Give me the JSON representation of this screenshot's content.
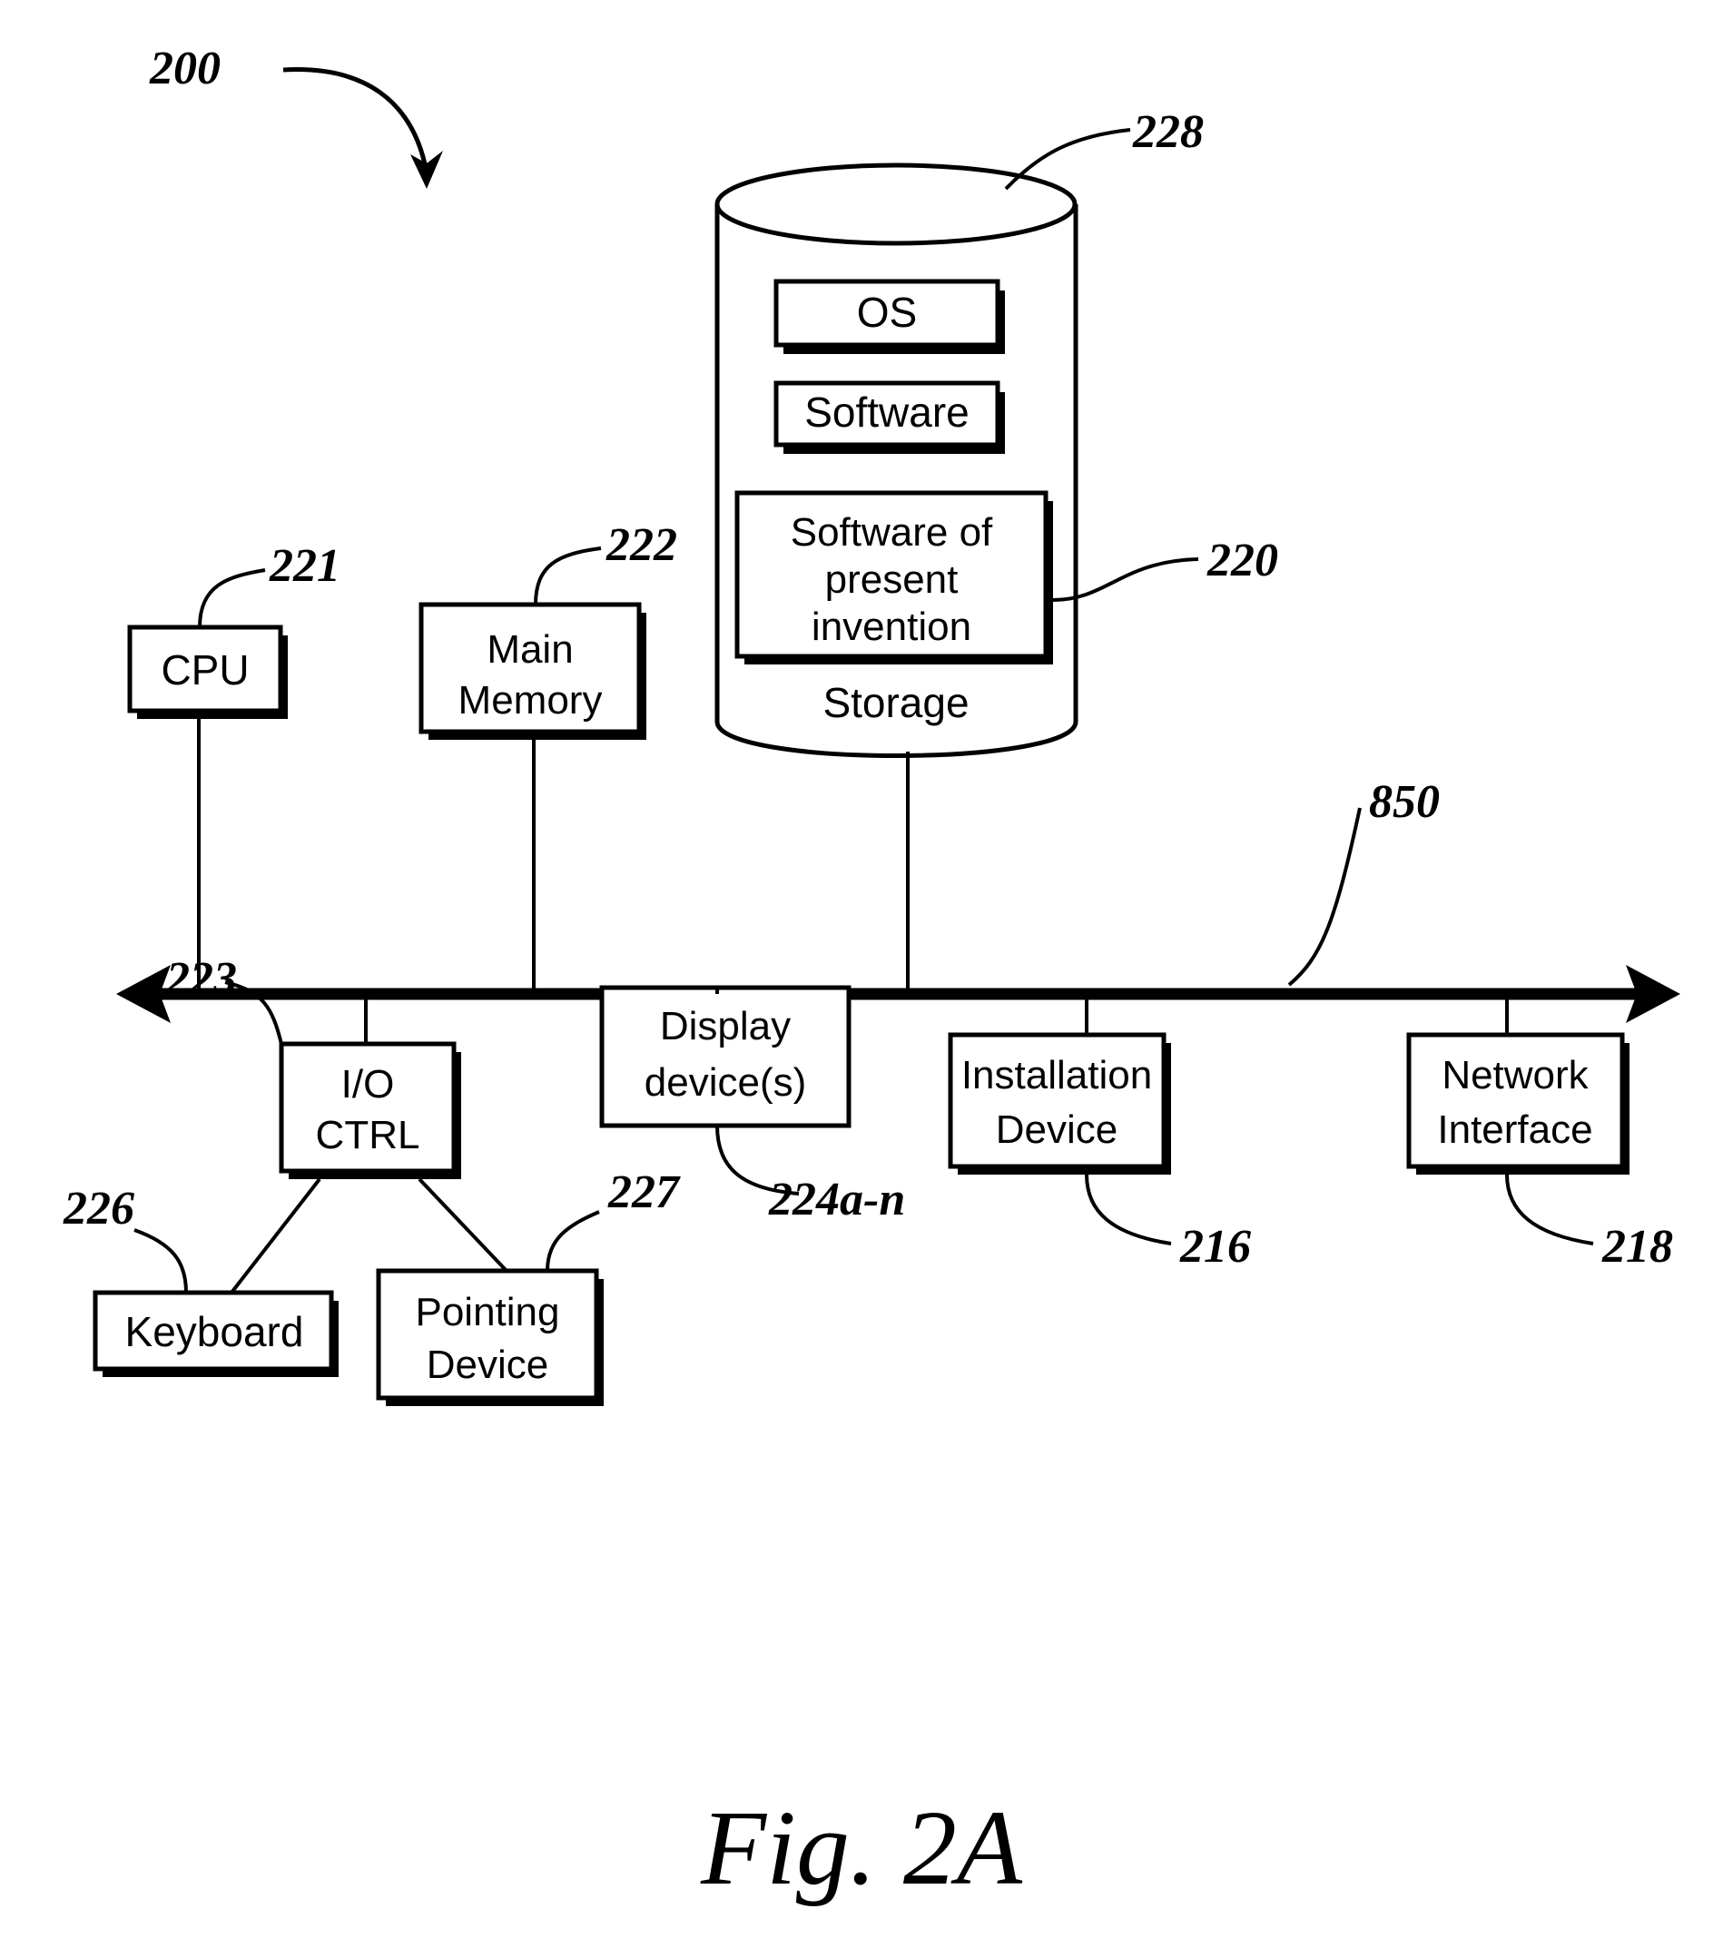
{
  "figure": {
    "caption": "Fig. 2A",
    "system_ref": "200",
    "bus_ref": "850"
  },
  "storage": {
    "ref": "228",
    "label": "Storage",
    "contents": [
      {
        "label": "OS"
      },
      {
        "label": "Software"
      },
      {
        "label": "Software of present invention",
        "lines": [
          "Software of",
          "present",
          "invention"
        ],
        "ref": "220"
      }
    ]
  },
  "components": [
    {
      "id": "cpu",
      "lines": [
        "CPU"
      ],
      "ref": "221"
    },
    {
      "id": "main-memory",
      "lines": [
        "Main",
        "Memory"
      ],
      "ref": "222"
    },
    {
      "id": "io-ctrl",
      "lines": [
        "I/O",
        "CTRL"
      ],
      "ref": "223"
    },
    {
      "id": "display-devices",
      "lines": [
        "Display",
        "device(s)"
      ],
      "ref": "224a-n"
    },
    {
      "id": "installation-device",
      "lines": [
        "Installation",
        "Device"
      ],
      "ref": "216"
    },
    {
      "id": "network-interface",
      "lines": [
        "Network",
        "Interface"
      ],
      "ref": "218"
    },
    {
      "id": "keyboard",
      "lines": [
        "Keyboard"
      ],
      "ref": "226"
    },
    {
      "id": "pointing-device",
      "lines": [
        "Pointing",
        "Device"
      ],
      "ref": "227"
    }
  ],
  "colors": {
    "ink": "#000000",
    "paper": "#ffffff"
  }
}
